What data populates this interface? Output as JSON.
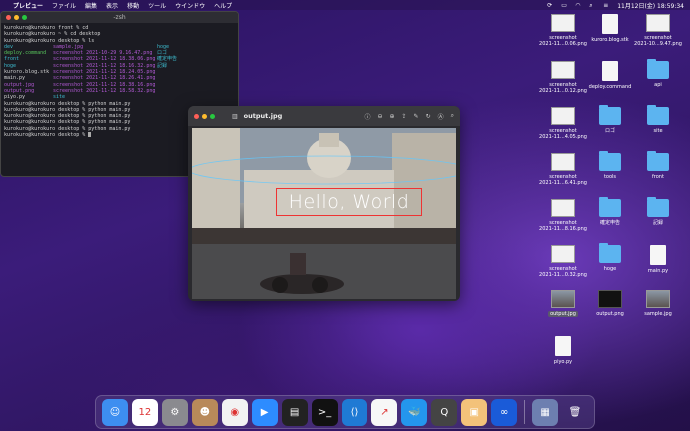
{
  "menubar": {
    "app": "プレビュー",
    "items": [
      "ファイル",
      "編集",
      "表示",
      "移動",
      "ツール",
      "ウインドウ",
      "ヘルプ"
    ],
    "clock": "11月12日(金) 18:59:34"
  },
  "terminal": {
    "title": "-zsh",
    "lines": [
      {
        "text": "kurokuro@kurokuro front % cd",
        "cls": ""
      },
      {
        "text": "kurokuro@kurokuro ~ % cd desktop",
        "cls": ""
      },
      {
        "text": "kurokuro@kurokuro desktop % ls",
        "cls": ""
      }
    ],
    "ls_rows": [
      [
        "dev",
        "sample.jpg",
        "hoge"
      ],
      [
        "deploy.command",
        "screenshot 2021-10-29 9.16.47.png",
        "ロゴ"
      ],
      [
        "front",
        "screenshot 2021-11-12 18.38.06.png",
        "確定申告"
      ],
      [
        "hoge",
        "screenshot 2021-11-12 18.16.32.png",
        "記録"
      ],
      [
        "kuroro.blog.stk",
        "screenshot 2021-11-12 18.24.05.png",
        ""
      ],
      [
        "main.py",
        "screenshot 2021-11-12 18.26.41.png",
        ""
      ],
      [
        "output.jpg",
        "screenshot 2021-11-12 18.38.16.png",
        ""
      ],
      [
        "output.png",
        "screenshot 2021-11-12 18.58.32.png",
        ""
      ],
      [
        "piyo.py",
        "site",
        ""
      ]
    ],
    "after": [
      "kurokuro@kurokuro desktop % python main.py",
      "kurokuro@kurokuro desktop % python main.py",
      "kurokuro@kurokuro desktop % python main.py",
      "kurokuro@kurokuro desktop % python main.py",
      "kurokuro@kurokuro desktop % python main.py",
      "kurokuro@kurokuro desktop % "
    ]
  },
  "preview": {
    "filename": "output.jpg",
    "overlay_text": "Hello, World"
  },
  "desktop": [
    {
      "label": "screenshot\n2021-11...0.06.png",
      "kind": "thumb"
    },
    {
      "label": "kuroro.blog.stk",
      "kind": "doc"
    },
    {
      "label": "screenshot\n2021-10...9.47.png",
      "kind": "thumb"
    },
    {
      "label": "screenshot\n2021-11...0.12.png",
      "kind": "thumb"
    },
    {
      "label": "deploy.command",
      "kind": "doc"
    },
    {
      "label": "api",
      "kind": "folder"
    },
    {
      "label": "screenshot\n2021-11...4.05.png",
      "kind": "thumb"
    },
    {
      "label": "ロゴ",
      "kind": "folder"
    },
    {
      "label": "site",
      "kind": "folder"
    },
    {
      "label": "screenshot\n2021-11...6.41.png",
      "kind": "thumb"
    },
    {
      "label": "tools",
      "kind": "folder"
    },
    {
      "label": "front",
      "kind": "folder"
    },
    {
      "label": "screenshot\n2021-11...8.16.png",
      "kind": "thumb"
    },
    {
      "label": "確定申告",
      "kind": "folder"
    },
    {
      "label": "記録",
      "kind": "folder"
    },
    {
      "label": "screenshot\n2021-11...0.32.png",
      "kind": "thumb"
    },
    {
      "label": "hoge",
      "kind": "folder"
    },
    {
      "label": "main.py",
      "kind": "doc"
    },
    {
      "label": "output.jpg",
      "kind": "photo",
      "selected": true
    },
    {
      "label": "output.png",
      "kind": "dark"
    },
    {
      "label": "sample.jpg",
      "kind": "photo"
    },
    {
      "label": "piyo.py",
      "kind": "doc"
    }
  ],
  "dock": [
    {
      "name": "finder",
      "bg": "#3d8ef0",
      "glyph": "☺"
    },
    {
      "name": "calendar",
      "bg": "#ffffff",
      "glyph": "12"
    },
    {
      "name": "system-preferences",
      "bg": "#8a8a8f",
      "glyph": "⚙"
    },
    {
      "name": "contacts",
      "bg": "#b8895a",
      "glyph": "☻"
    },
    {
      "name": "chrome",
      "bg": "#f2f2f2",
      "glyph": "◉"
    },
    {
      "name": "zoom",
      "bg": "#2d8cff",
      "glyph": "▶"
    },
    {
      "name": "activity-monitor",
      "bg": "#222",
      "glyph": "▤"
    },
    {
      "name": "terminal",
      "bg": "#111",
      "glyph": ">_"
    },
    {
      "name": "vscode",
      "bg": "#1f7ad4",
      "glyph": "⟨⟩"
    },
    {
      "name": "app-orange",
      "bg": "#f7f7f7",
      "glyph": "↗"
    },
    {
      "name": "docker",
      "bg": "#2496ed",
      "glyph": "🐳"
    },
    {
      "name": "quicktime",
      "bg": "#444",
      "glyph": "Q"
    },
    {
      "name": "preview",
      "bg": "#f3c27a",
      "glyph": "▣"
    },
    {
      "name": "infinity",
      "bg": "#1a5bd8",
      "glyph": "∞"
    },
    {
      "name": "downloads",
      "bg": "#6d7fb0",
      "glyph": "▦"
    },
    {
      "name": "trash",
      "bg": "transparent",
      "glyph": "🗑"
    }
  ]
}
